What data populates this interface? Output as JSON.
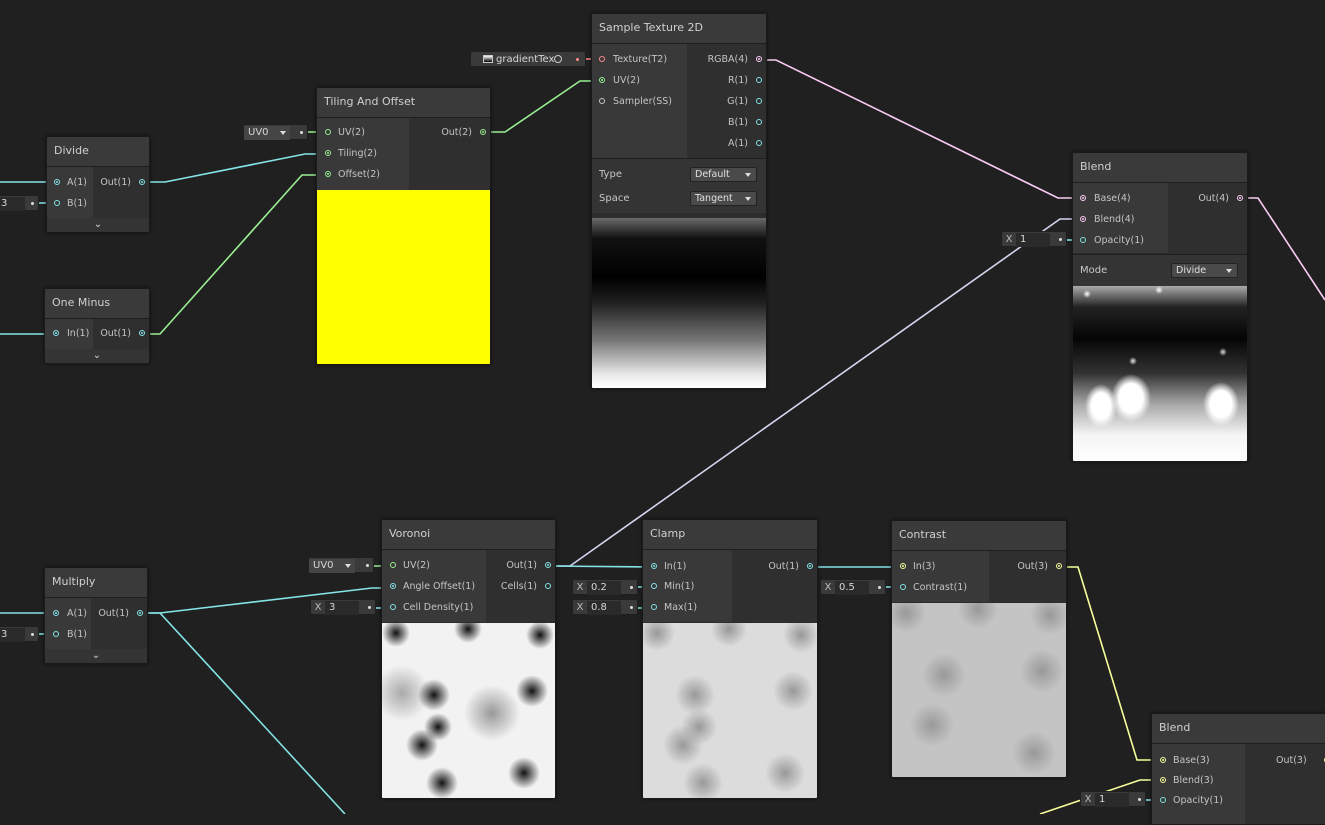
{
  "nodes": {
    "divide": {
      "title": "Divide",
      "in_a": "A(1)",
      "in_b": "B(1)",
      "out": "Out(1)",
      "partial_value": "3"
    },
    "one_minus": {
      "title": "One Minus",
      "in": "In(1)",
      "out": "Out(1)"
    },
    "multiply": {
      "title": "Multiply",
      "in_a": "A(1)",
      "in_b": "B(1)",
      "out": "Out(1)",
      "partial_value": "3"
    },
    "tiling_offset": {
      "title": "Tiling And Offset",
      "in_uv": "UV(2)",
      "in_tiling": "Tiling(2)",
      "in_offset": "Offset(2)",
      "out": "Out(2)",
      "uv_dropdown": "UV0",
      "preview_color": "#ffff00"
    },
    "sample_texture": {
      "title": "Sample Texture 2D",
      "in_texture": "Texture(T2)",
      "in_uv": "UV(2)",
      "in_sampler": "Sampler(SS)",
      "out_rgba": "RGBA(4)",
      "out_r": "R(1)",
      "out_g": "G(1)",
      "out_b": "B(1)",
      "out_a": "A(1)",
      "type_label": "Type",
      "type_value": "Default",
      "space_label": "Space",
      "space_value": "Tangent",
      "texture_name": "gradientTex"
    },
    "blend_top": {
      "title": "Blend",
      "in_base": "Base(4)",
      "in_blend": "Blend(4)",
      "in_opacity": "Opacity(1)",
      "out": "Out(4)",
      "mode_label": "Mode",
      "mode_value": "Divide",
      "opacity_x": "X",
      "opacity_value": "1"
    },
    "voronoi": {
      "title": "Voronoi",
      "in_uv": "UV(2)",
      "in_angle": "Angle Offset(1)",
      "in_density": "Cell Density(1)",
      "out": "Out(1)",
      "out_cells": "Cells(1)",
      "uv_dropdown": "UV0",
      "density_x": "X",
      "density_value": "3"
    },
    "clamp": {
      "title": "Clamp",
      "in": "In(1)",
      "in_min": "Min(1)",
      "in_max": "Max(1)",
      "out": "Out(1)",
      "min_x": "X",
      "min_value": "0.2",
      "max_x": "X",
      "max_value": "0.8"
    },
    "contrast": {
      "title": "Contrast",
      "in": "In(3)",
      "in_contrast": "Contrast(1)",
      "out": "Out(3)",
      "contrast_x": "X",
      "contrast_value": "0.5"
    },
    "blend_bottom": {
      "title": "Blend",
      "in_base": "Base(3)",
      "in_blend": "Blend(3)",
      "in_opacity": "Opacity(1)",
      "out": "Out(3)",
      "opacity_x": "X",
      "opacity_value": "1"
    }
  },
  "colors": {
    "background": "#202020",
    "float_wire": "#84e4e7",
    "vector2_wire": "#9aef92",
    "vector3_wire": "#f6ff9a",
    "vector4_wire": "#fbcbf4",
    "texture_wire": "#ff8b8b",
    "node_body": "#2c2c2c",
    "node_title": "#3a3a3a"
  },
  "icons": [
    "chevron-down-icon",
    "texture-swatch-icon",
    "target-picker-icon"
  ]
}
